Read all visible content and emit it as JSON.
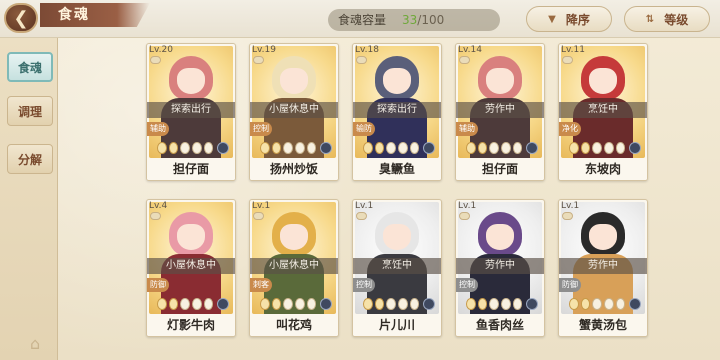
{
  "header": {
    "title": "食魂",
    "capacity_label": "食魂容量",
    "capacity_current": "33",
    "capacity_sep": "/",
    "capacity_max": "100",
    "sort_desc_label": "降序",
    "sort_level_label": "等级"
  },
  "sidebar": {
    "items": [
      {
        "label": "食魂",
        "active": true
      },
      {
        "label": "调理",
        "active": false
      },
      {
        "label": "分解",
        "active": false
      }
    ]
  },
  "cards": [
    {
      "level": "Lv.20",
      "status": "探索出行",
      "role": "辅助",
      "name": "担仔面",
      "role_color": "#c98a4b",
      "hair": "#d9807e",
      "outfit": "#4d3a3a",
      "bg": "gold"
    },
    {
      "level": "Lv.19",
      "status": "小屋休息中",
      "role": "控制",
      "name": "扬州炒饭",
      "role_color": "#c98a4b",
      "hair": "#efe0b6",
      "outfit": "#7b5a3a",
      "bg": "gold"
    },
    {
      "level": "Lv.18",
      "status": "探索出行",
      "role": "输防",
      "name": "臭鳜鱼",
      "role_color": "#c98a4b",
      "hair": "#5a5f7a",
      "outfit": "#30305a",
      "bg": "gold"
    },
    {
      "level": "Lv.14",
      "status": "劳作中",
      "role": "辅助",
      "name": "担仔面",
      "role_color": "#c98a4b",
      "hair": "#d9807e",
      "outfit": "#4d3a3a",
      "bg": "gold"
    },
    {
      "level": "Lv.11",
      "status": "烹饪中",
      "role": "净化",
      "name": "东坡肉",
      "role_color": "#c98a4b",
      "hair": "#c53a3a",
      "outfit": "#6a2b2b",
      "bg": "gold"
    },
    {
      "level": "Lv.4",
      "status": "小屋休息中",
      "role": "防御",
      "name": "灯影牛肉",
      "role_color": "#c98a4b",
      "hair": "#e99aa6",
      "outfit": "#8a2c32",
      "bg": "gold"
    },
    {
      "level": "Lv.1",
      "status": "小屋休息中",
      "role": "刺客",
      "name": "叫花鸡",
      "role_color": "#c98a4b",
      "hair": "#e3b04a",
      "outfit": "#5a6a3a",
      "bg": "gold"
    },
    {
      "level": "Lv.1",
      "status": "烹饪中",
      "role": "控制",
      "name": "片儿川",
      "role_color": "#8e8e8e",
      "hair": "#e6e6e6",
      "outfit": "#3a3a40",
      "bg": "white"
    },
    {
      "level": "Lv.1",
      "status": "劳作中",
      "role": "控制",
      "name": "鱼香肉丝",
      "role_color": "#8e8e8e",
      "hair": "#6a4a8a",
      "outfit": "#2a2a3a",
      "bg": "white"
    },
    {
      "level": "Lv.1",
      "status": "劳作中",
      "role": "防御",
      "name": "蟹黄汤包",
      "role_color": "#8e8e8e",
      "hair": "#2a2a2a",
      "outfit": "#d8a058",
      "bg": "white"
    }
  ],
  "icons": {
    "back": "chevron-left-icon",
    "sort": "triangle-down-icon",
    "level": "sort-arrows-icon"
  }
}
